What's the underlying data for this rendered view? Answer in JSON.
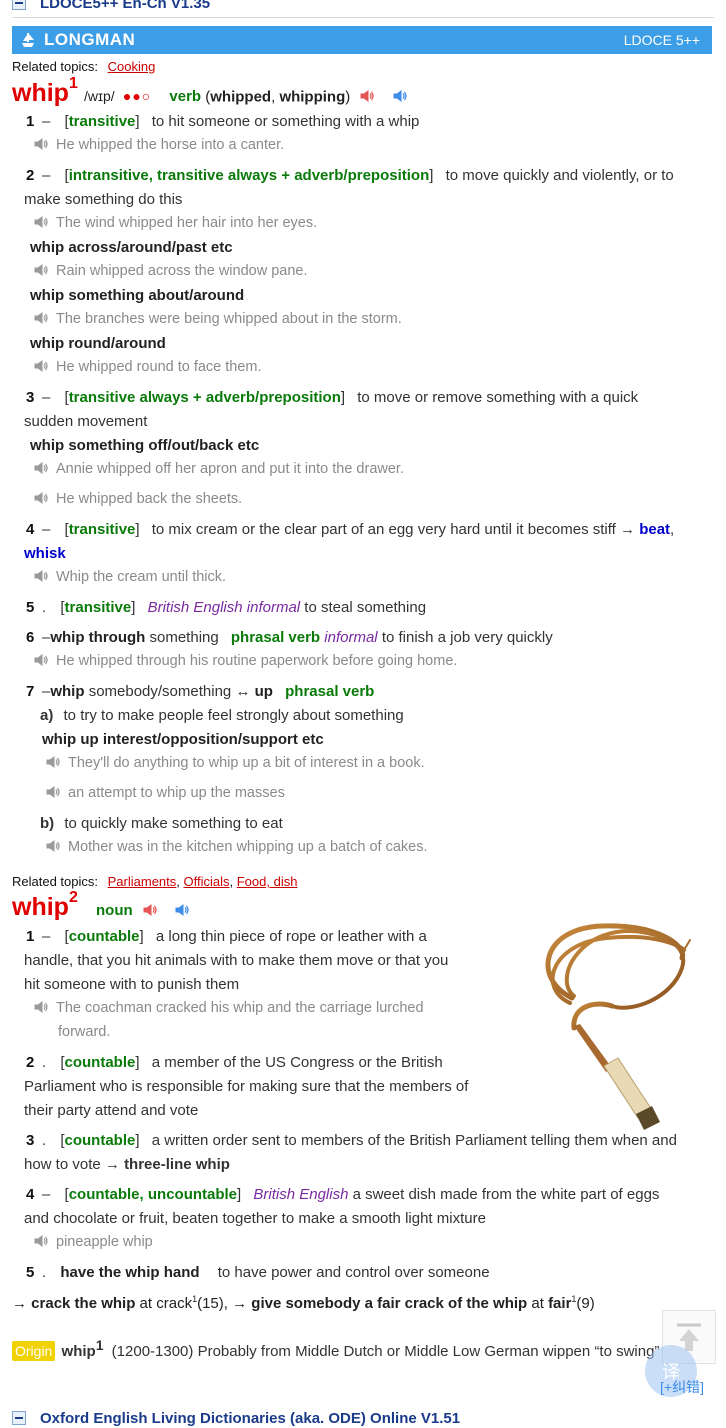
{
  "top_dict": {
    "title": "LDOCE5++ En-Ch V1.35"
  },
  "banner": {
    "brand": "LONGMAN",
    "version": "LDOCE 5++"
  },
  "entry1": {
    "related_label": "Related topics:",
    "related": [
      "Cooking"
    ],
    "headword": "whip",
    "hom": "1",
    "pron": "/wɪp/",
    "freq": "●●○",
    "pos": "verb",
    "forms_open": "(",
    "form1": "whipped",
    "form2": "whipping",
    "forms_close": ")",
    "s1": {
      "num": "1",
      "gram": "transitive",
      "def": "to hit someone or something with a whip",
      "ex": "He whipped the horse into a canter."
    },
    "s2": {
      "num": "2",
      "gram": "intransitive, transitive always + adverb/preposition",
      "def_line1": "to move quickly and violently, or to",
      "def_line2": "make something do this",
      "ex": "The wind whipped her hair into her eyes.",
      "phr1": "whip across/around/past etc",
      "ex1": "Rain whipped across the window pane.",
      "phr2": "whip something about/around",
      "ex2": "The branches were being whipped about in the storm.",
      "phr3": "whip round/around",
      "ex3": "He whipped round to face them."
    },
    "s3": {
      "num": "3",
      "gram": "transitive always + adverb/preposition",
      "def_line1": "to move or remove something with a quick",
      "def_line2": "sudden movement",
      "phr": "whip something off/out/back etc",
      "ex1": "Annie whipped off her apron and put it into the drawer.",
      "ex2": "He whipped back the sheets."
    },
    "s4": {
      "num": "4",
      "gram": "transitive",
      "def": "to mix cream or the clear part of an egg very hard until it becomes stiff",
      "arrow": "→",
      "xref1": "beat",
      "xref2": "whisk",
      "ex": "Whip the cream until thick."
    },
    "s5": {
      "num": "5",
      "gram": "transitive",
      "reg": "British English informal",
      "def": "to steal something"
    },
    "s6": {
      "num": "6",
      "phr": "whip through",
      "obj": "something",
      "pos": "phrasal verb",
      "reg": "informal",
      "def": "to finish a job very quickly",
      "ex": "He whipped through his routine paperwork before going home."
    },
    "s7": {
      "num": "7",
      "phr": "whip",
      "obj": "somebody/something",
      "arrows": "↔",
      "particle": "up",
      "pos": "phrasal verb",
      "a_label": "a)",
      "a_def": "to try to make people feel strongly about something",
      "a_phr": "whip up interest/opposition/support etc",
      "a_ex1": "They'll do anything to whip up a bit of interest in a book.",
      "a_ex2": "an attempt to whip up the masses",
      "b_label": "b)",
      "b_def": "to quickly make something to eat",
      "b_ex": "Mother was in the kitchen whipping up a batch of cakes."
    }
  },
  "entry2": {
    "related_label": "Related topics:",
    "related": [
      "Parliaments",
      "Officials",
      "Food, dish"
    ],
    "headword": "whip",
    "hom": "2",
    "pos": "noun",
    "s1": {
      "num": "1",
      "gram": "countable",
      "def_line1": "a long thin piece of rope or leather with a",
      "def_line2": "handle, that you hit animals with to make them move or that you",
      "def_line3": "hit someone with to punish them",
      "ex_line1": "The coachman cracked his whip and the carriage lurched",
      "ex_line2": "forward."
    },
    "s2": {
      "num": "2",
      "gram": "countable",
      "def_line1": "a member of the US Congress or the British",
      "def_line2": "Parliament who is responsible for making sure that the members of",
      "def_line3": "their party attend and vote"
    },
    "s3": {
      "num": "3",
      "gram": "countable",
      "def_line1": "a written order sent to members of the British Parliament telling them when and",
      "def_line2": "how to vote",
      "arrow": "→",
      "xref": "three-line whip"
    },
    "s4": {
      "num": "4",
      "gram": "countable, uncountable",
      "reg": "British English",
      "def_line1": "a sweet dish made from the white part of eggs",
      "def_line2": "and chocolate or fruit, beaten together to make a smooth light mixture",
      "ex": "pineapple whip"
    },
    "s5": {
      "num": "5",
      "phr": "have the whip hand",
      "def": "to have power and control over someone"
    },
    "crossref": {
      "a1": "→",
      "p1": "crack the whip",
      "at1": "at",
      "w1": "crack",
      "s1": "1",
      "n1": "(15),",
      "a2": "→",
      "p2": "give somebody a fair crack of the whip",
      "at2": "at",
      "w2": "fair",
      "s2": "1",
      "n2": "(9)"
    },
    "origin": {
      "tag": "Origin",
      "word": "whip",
      "sup": "1",
      "text": "(1200-1300) Probably from Middle Dutch or Middle Low German wippen “to swing”"
    }
  },
  "sidebar": {
    "correct_label": "[+纠错]"
  },
  "bottom_dict": {
    "title": "Oxford English Living Dictionaries (aka. ODE) Online V1.51"
  },
  "colors": {
    "banner": "#3d9ee8",
    "headword": "#e00000",
    "grammar": "#0a7a0a",
    "xref": "#0000cc",
    "register": "#7a2aa0",
    "origin_tag": "#f2d100"
  }
}
